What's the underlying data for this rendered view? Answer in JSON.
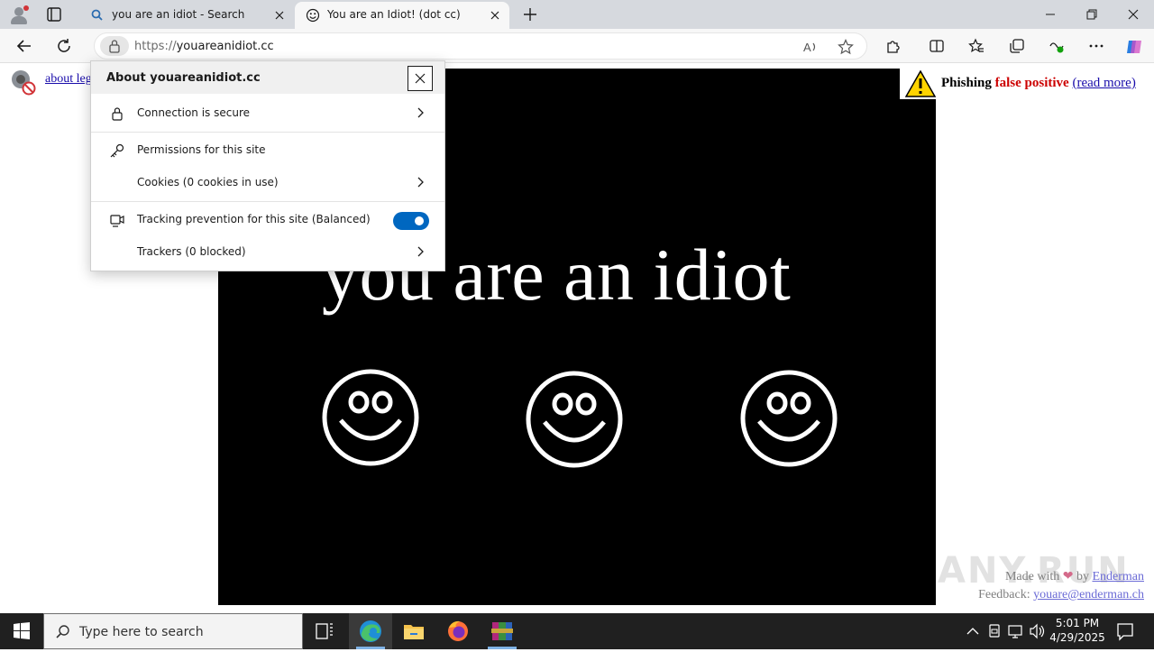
{
  "browser": {
    "tabs": [
      {
        "label": "you are an idiot - Search",
        "icon": "search-icon"
      },
      {
        "label": "You are an Idiot! (dot cc)",
        "icon": "smiley-icon",
        "active": true
      }
    ],
    "url_protocol": "https://",
    "url_host": "youareanidiot.cc"
  },
  "popup": {
    "title": "About youareanidiot.cc",
    "connection": "Connection is secure",
    "permissions": "Permissions for this site",
    "cookies": "Cookies (0 cookies in use)",
    "tracking": "Tracking prevention for this site (Balanced)",
    "tracking_enabled": true,
    "trackers": "Trackers (0 blocked)"
  },
  "page": {
    "about_links": "about leg",
    "headline": "you are an idiot",
    "phishing_prefix": "Phishing ",
    "phishing_highlight": "false positive",
    "phishing_link": "(read more)",
    "credit_prefix": "Made with ",
    "credit_by": " by ",
    "credit_author": "Enderman",
    "feedback_label": "Feedback: ",
    "feedback_email": "youare@enderman.ch",
    "watermark": "ANY.RUN"
  },
  "taskbar": {
    "search_placeholder": "Type here to search",
    "time": "5:01 PM",
    "date": "4/29/2025"
  },
  "colors": {
    "accent": "#0067c0",
    "stage": "#000000",
    "warning_red": "#cc0000"
  }
}
